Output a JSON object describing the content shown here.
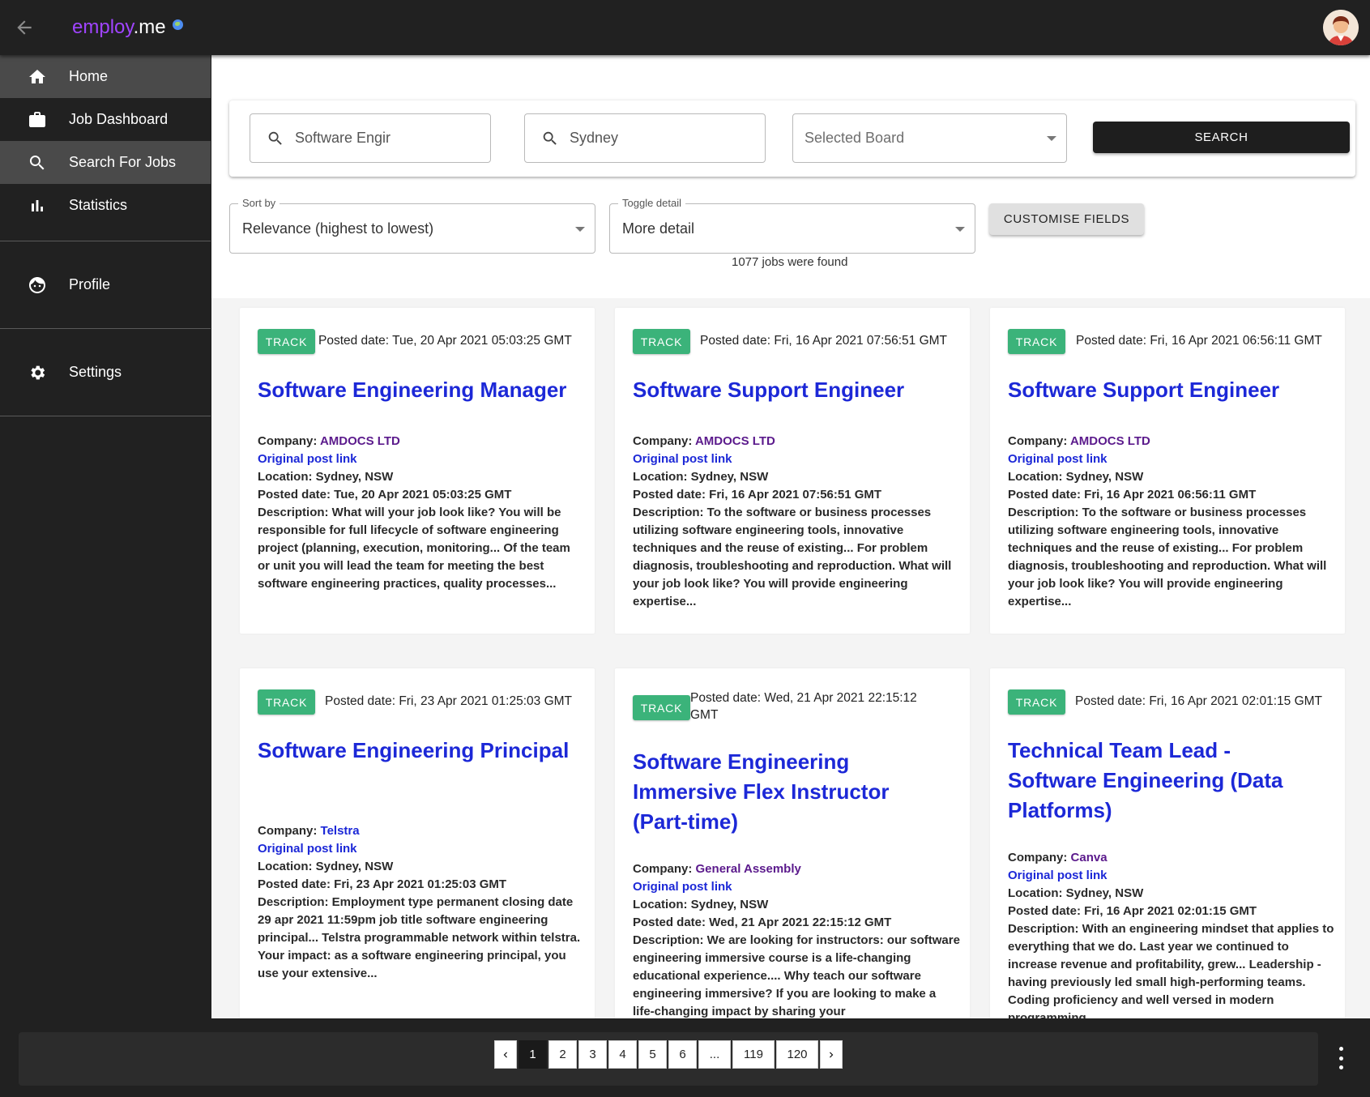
{
  "app": {
    "brand": "employ",
    "brand_suffix": ".me"
  },
  "sidebar": {
    "items": [
      {
        "label": "Home",
        "icon": "home-icon"
      },
      {
        "label": "Job Dashboard",
        "icon": "briefcase-icon"
      },
      {
        "label": "Search For Jobs",
        "icon": "search-icon"
      },
      {
        "label": "Statistics",
        "icon": "bar-chart-icon"
      },
      {
        "label": "Profile",
        "icon": "face-icon"
      },
      {
        "label": "Settings",
        "icon": "gear-icon"
      }
    ]
  },
  "search": {
    "keyword": "Software Engir",
    "location": "Sydney",
    "board_placeholder": "Selected Board",
    "button": "SEARCH"
  },
  "controls": {
    "sort_legend": "Sort by",
    "sort_value": "Relevance (highest to lowest)",
    "toggle_legend": "Toggle detail",
    "toggle_value": "More detail",
    "customise": "CUSTOMISE FIELDS",
    "found": "1077 jobs were found"
  },
  "jobs": [
    {
      "track": "TRACK",
      "posted": "Posted date: Tue, 20 Apr 2021 05:03:25 GMT",
      "title": "Software Engineering Manager",
      "company_label": "Company: ",
      "company": "AMDOCS LTD",
      "link": "Original post link",
      "location": "Location: Sydney, NSW",
      "posted_detail": "Posted date: Tue, 20 Apr 2021 05:03:25 GMT",
      "description": "Description: What will your job look like? You will be responsible for full lifecycle of software engineering project (planning, execution, monitoring... Of the team or unit you will lead the team for meeting the best software engineering practices, quality processes..."
    },
    {
      "track": "TRACK",
      "posted": "Posted date: Fri, 16 Apr 2021 07:56:51 GMT",
      "title": "Software Support Engineer",
      "company_label": "Company: ",
      "company": "AMDOCS LTD",
      "link": "Original post link",
      "location": "Location: Sydney, NSW",
      "posted_detail": "Posted date: Fri, 16 Apr 2021 07:56:51 GMT",
      "description": "Description: To the software or business processes utilizing software engineering tools, innovative techniques and the reuse of existing... For problem diagnosis, troubleshooting and reproduction. What will your job look like? You will provide engineering expertise..."
    },
    {
      "track": "TRACK",
      "posted": "Posted date: Fri, 16 Apr 2021 06:56:11 GMT",
      "title": "Software Support Engineer",
      "company_label": "Company: ",
      "company": "AMDOCS LTD",
      "link": "Original post link",
      "location": "Location: Sydney, NSW",
      "posted_detail": "Posted date: Fri, 16 Apr 2021 06:56:11 GMT",
      "description": "Description: To the software or business processes utilizing software engineering tools, innovative techniques and the reuse of existing... For problem diagnosis, troubleshooting and reproduction. What will your job look like? You will provide engineering expertise..."
    },
    {
      "track": "TRACK",
      "posted": "Posted date: Fri, 23 Apr 2021 01:25:03 GMT",
      "title": "Software Engineering Principal",
      "company_label": "Company: ",
      "company": "Telstra",
      "link": "Original post link",
      "location": "Location: Sydney, NSW",
      "posted_detail": "Posted date: Fri, 23 Apr 2021 01:25:03 GMT",
      "description": "Description: Employment type permanent closing date 29 apr 2021 11:59pm job title software engineering principal... Telstra programmable network within telstra. Your impact: as a software engineering principal, you use your extensive..."
    },
    {
      "track": "TRACK",
      "posted": "Posted date: Wed, 21 Apr 2021 22:15:12 GMT",
      "title": "Software Engineering Immersive Flex Instructor (Part-time)",
      "company_label": "Company: ",
      "company": "General Assembly",
      "link": "Original post link",
      "location": "Location: Sydney, NSW",
      "posted_detail": "Posted date: Wed, 21 Apr 2021 22:15:12 GMT",
      "description": "Description: We are looking for instructors: our software engineering immersive course is a life-changing educational experience.... Why teach our software engineering immersive? If you are looking to make a life-changing impact by sharing your"
    },
    {
      "track": "TRACK",
      "posted": "Posted date: Fri, 16 Apr 2021 02:01:15 GMT",
      "title": "Technical Team Lead - Software Engineering (Data Platforms)",
      "company_label": "Company: ",
      "company": "Canva",
      "link": "Original post link",
      "location": "Location: Sydney, NSW",
      "posted_detail": "Posted date: Fri, 16 Apr 2021 02:01:15 GMT",
      "description": "Description: With an engineering mindset that applies to everything that we do. Last year we continued to increase revenue and profitability, grew... Leadership - having previously led small high-performing teams. Coding proficiency and well versed in modern programming"
    }
  ],
  "pagination": {
    "pages": [
      "1",
      "2",
      "3",
      "4",
      "5",
      "6",
      "...",
      "119",
      "120"
    ],
    "current": "1"
  }
}
